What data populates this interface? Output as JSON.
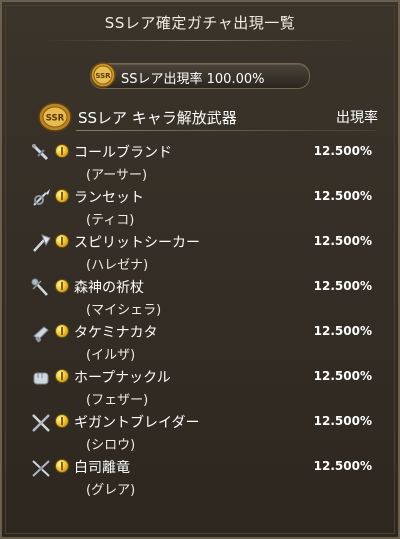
{
  "window": {
    "title": "SSレア確定ガチャ出現一覧"
  },
  "summary": {
    "label": "SSレア出現率 100.00%",
    "badge_text": "SSR"
  },
  "section": {
    "title": "SSレア キャラ解放武器",
    "rate_header": "出現率",
    "badge_text": "SSR"
  },
  "items": [
    {
      "name": "コールブランド",
      "chara": "(アーサー)",
      "rate": "12.500%",
      "weapon_icon": "sword-icon"
    },
    {
      "name": "ランセット",
      "chara": "(ティコ)",
      "rate": "12.500%",
      "weapon_icon": "spear-icon"
    },
    {
      "name": "スピリットシーカー",
      "chara": "(ハレゼナ)",
      "rate": "12.500%",
      "weapon_icon": "axe-icon"
    },
    {
      "name": "森神の祈杖",
      "chara": "(マイシェラ)",
      "rate": "12.500%",
      "weapon_icon": "staff-icon"
    },
    {
      "name": "タケミナカタ",
      "chara": "(イルザ)",
      "rate": "12.500%",
      "weapon_icon": "gun-icon"
    },
    {
      "name": "ホープナックル",
      "chara": "(フェザー)",
      "rate": "12.500%",
      "weapon_icon": "fist-icon"
    },
    {
      "name": "ギガントブレイダー",
      "chara": "(シロウ)",
      "rate": "12.500%",
      "weapon_icon": "crossed-swords-icon"
    },
    {
      "name": "白司離竜",
      "chara": "(グレア)",
      "rate": "12.500%",
      "weapon_icon": "crossed-katana-icon"
    }
  ]
}
